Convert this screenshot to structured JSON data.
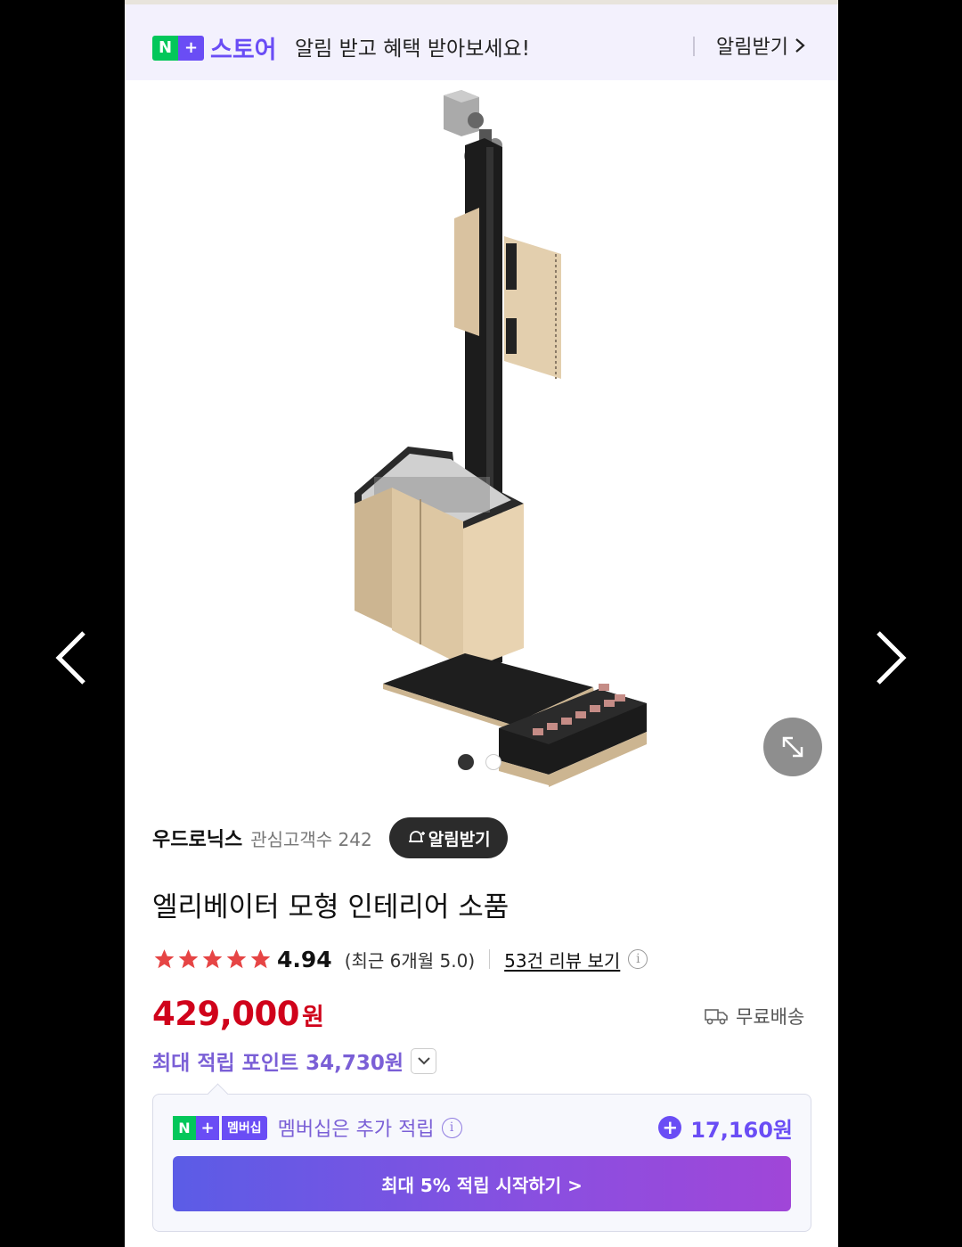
{
  "banner": {
    "np_n": "N",
    "np_plus": "+",
    "store_label": "스토어",
    "message": "알림 받고 혜택 받아보세요!",
    "notify_label": "알림받기"
  },
  "gallery": {
    "dots": 2,
    "active_index": 0
  },
  "seller": {
    "name": "우드로닉스",
    "interest": "관심고객수 242",
    "notify_btn": "알림받기"
  },
  "product": {
    "title": "엘리베이터 모형 인테리어 소품",
    "rating": "4.94",
    "recent_rating": "(최근 6개월 5.0)",
    "review_link": "53건 리뷰 보기",
    "price": "429,000",
    "price_unit": "원",
    "shipping": "무료배송",
    "max_points": "최대 적립 포인트 34,730원"
  },
  "membership": {
    "logo_n": "N",
    "logo_plus": "+",
    "tag": "멤버십",
    "text": "멤버십은 추가 적립",
    "points": "17,160원",
    "cta": "최대 5% 적립 시작하기 >"
  },
  "colors": {
    "price": "#d0021b",
    "accent": "#6a4df5",
    "star": "#e64545",
    "naver_green": "#03c75a"
  },
  "icons": {
    "prev": "chevron-left-icon",
    "next": "chevron-right-icon",
    "expand": "expand-icon",
    "truck": "truck-icon",
    "bell": "bell-icon"
  }
}
